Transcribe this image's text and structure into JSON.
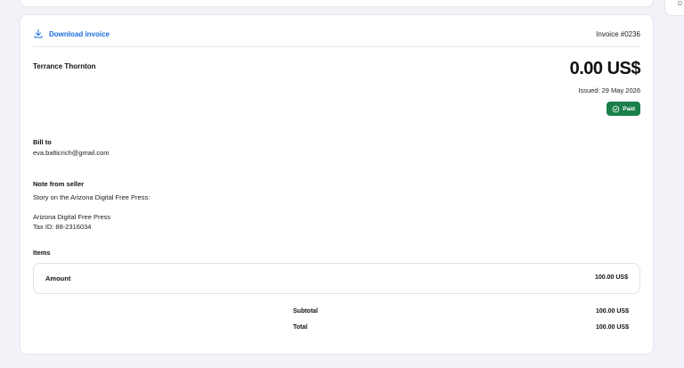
{
  "side_panel": {
    "text": "D"
  },
  "invoice": {
    "download_label": "Download invoice",
    "number": "Invoice #0236",
    "buyer_name": "Terrance Thornton",
    "amount": "0.00 US$",
    "issued": "Issued: 29 May 2026",
    "status": "Paid"
  },
  "bill_to": {
    "heading": "Bill to",
    "email": "eva.balticrich@gmail.com"
  },
  "note": {
    "heading": "Note from seller",
    "line1": "Story on the Arizona Digital Free Press:",
    "line2": "Arizona Digital Free Press",
    "line3": "Tax ID: 88-2316034"
  },
  "items": {
    "heading": "Items",
    "column_label": "Amount",
    "column_value": "100.00 US$"
  },
  "totals": {
    "subtotal_label": "Subtotal",
    "subtotal_value": "100.00 US$",
    "total_label": "Total",
    "total_value": "100.00 US$"
  }
}
